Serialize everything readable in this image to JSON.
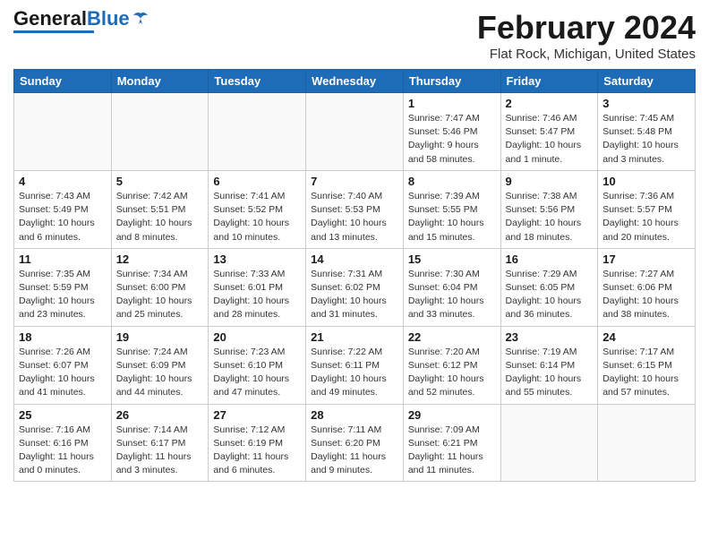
{
  "header": {
    "logo_general": "General",
    "logo_blue": "Blue",
    "month_title": "February 2024",
    "location": "Flat Rock, Michigan, United States"
  },
  "days_of_week": [
    "Sunday",
    "Monday",
    "Tuesday",
    "Wednesday",
    "Thursday",
    "Friday",
    "Saturday"
  ],
  "weeks": [
    [
      {
        "day": "",
        "info": ""
      },
      {
        "day": "",
        "info": ""
      },
      {
        "day": "",
        "info": ""
      },
      {
        "day": "",
        "info": ""
      },
      {
        "day": "1",
        "info": "Sunrise: 7:47 AM\nSunset: 5:46 PM\nDaylight: 9 hours\nand 58 minutes."
      },
      {
        "day": "2",
        "info": "Sunrise: 7:46 AM\nSunset: 5:47 PM\nDaylight: 10 hours\nand 1 minute."
      },
      {
        "day": "3",
        "info": "Sunrise: 7:45 AM\nSunset: 5:48 PM\nDaylight: 10 hours\nand 3 minutes."
      }
    ],
    [
      {
        "day": "4",
        "info": "Sunrise: 7:43 AM\nSunset: 5:49 PM\nDaylight: 10 hours\nand 6 minutes."
      },
      {
        "day": "5",
        "info": "Sunrise: 7:42 AM\nSunset: 5:51 PM\nDaylight: 10 hours\nand 8 minutes."
      },
      {
        "day": "6",
        "info": "Sunrise: 7:41 AM\nSunset: 5:52 PM\nDaylight: 10 hours\nand 10 minutes."
      },
      {
        "day": "7",
        "info": "Sunrise: 7:40 AM\nSunset: 5:53 PM\nDaylight: 10 hours\nand 13 minutes."
      },
      {
        "day": "8",
        "info": "Sunrise: 7:39 AM\nSunset: 5:55 PM\nDaylight: 10 hours\nand 15 minutes."
      },
      {
        "day": "9",
        "info": "Sunrise: 7:38 AM\nSunset: 5:56 PM\nDaylight: 10 hours\nand 18 minutes."
      },
      {
        "day": "10",
        "info": "Sunrise: 7:36 AM\nSunset: 5:57 PM\nDaylight: 10 hours\nand 20 minutes."
      }
    ],
    [
      {
        "day": "11",
        "info": "Sunrise: 7:35 AM\nSunset: 5:59 PM\nDaylight: 10 hours\nand 23 minutes."
      },
      {
        "day": "12",
        "info": "Sunrise: 7:34 AM\nSunset: 6:00 PM\nDaylight: 10 hours\nand 25 minutes."
      },
      {
        "day": "13",
        "info": "Sunrise: 7:33 AM\nSunset: 6:01 PM\nDaylight: 10 hours\nand 28 minutes."
      },
      {
        "day": "14",
        "info": "Sunrise: 7:31 AM\nSunset: 6:02 PM\nDaylight: 10 hours\nand 31 minutes."
      },
      {
        "day": "15",
        "info": "Sunrise: 7:30 AM\nSunset: 6:04 PM\nDaylight: 10 hours\nand 33 minutes."
      },
      {
        "day": "16",
        "info": "Sunrise: 7:29 AM\nSunset: 6:05 PM\nDaylight: 10 hours\nand 36 minutes."
      },
      {
        "day": "17",
        "info": "Sunrise: 7:27 AM\nSunset: 6:06 PM\nDaylight: 10 hours\nand 38 minutes."
      }
    ],
    [
      {
        "day": "18",
        "info": "Sunrise: 7:26 AM\nSunset: 6:07 PM\nDaylight: 10 hours\nand 41 minutes."
      },
      {
        "day": "19",
        "info": "Sunrise: 7:24 AM\nSunset: 6:09 PM\nDaylight: 10 hours\nand 44 minutes."
      },
      {
        "day": "20",
        "info": "Sunrise: 7:23 AM\nSunset: 6:10 PM\nDaylight: 10 hours\nand 47 minutes."
      },
      {
        "day": "21",
        "info": "Sunrise: 7:22 AM\nSunset: 6:11 PM\nDaylight: 10 hours\nand 49 minutes."
      },
      {
        "day": "22",
        "info": "Sunrise: 7:20 AM\nSunset: 6:12 PM\nDaylight: 10 hours\nand 52 minutes."
      },
      {
        "day": "23",
        "info": "Sunrise: 7:19 AM\nSunset: 6:14 PM\nDaylight: 10 hours\nand 55 minutes."
      },
      {
        "day": "24",
        "info": "Sunrise: 7:17 AM\nSunset: 6:15 PM\nDaylight: 10 hours\nand 57 minutes."
      }
    ],
    [
      {
        "day": "25",
        "info": "Sunrise: 7:16 AM\nSunset: 6:16 PM\nDaylight: 11 hours\nand 0 minutes."
      },
      {
        "day": "26",
        "info": "Sunrise: 7:14 AM\nSunset: 6:17 PM\nDaylight: 11 hours\nand 3 minutes."
      },
      {
        "day": "27",
        "info": "Sunrise: 7:12 AM\nSunset: 6:19 PM\nDaylight: 11 hours\nand 6 minutes."
      },
      {
        "day": "28",
        "info": "Sunrise: 7:11 AM\nSunset: 6:20 PM\nDaylight: 11 hours\nand 9 minutes."
      },
      {
        "day": "29",
        "info": "Sunrise: 7:09 AM\nSunset: 6:21 PM\nDaylight: 11 hours\nand 11 minutes."
      },
      {
        "day": "",
        "info": ""
      },
      {
        "day": "",
        "info": ""
      }
    ]
  ]
}
